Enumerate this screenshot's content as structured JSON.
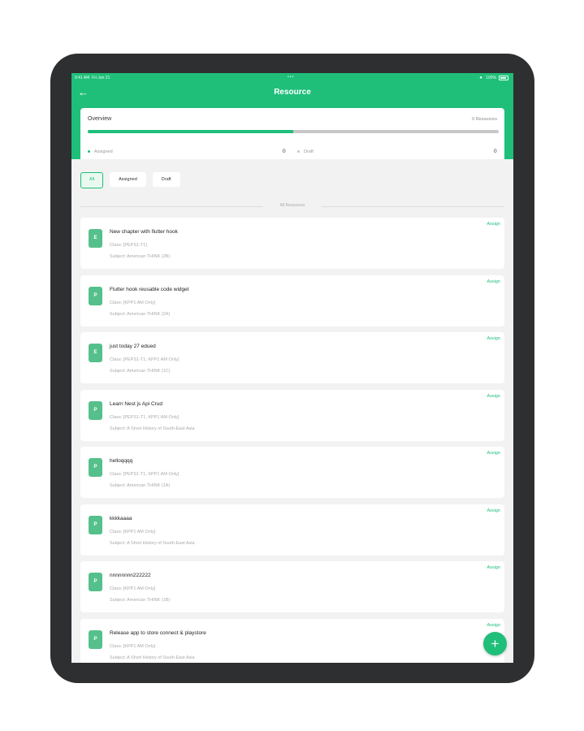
{
  "status_bar": {
    "time": "9:41 AM",
    "date": "Fri Jun 21",
    "dots": "•••",
    "battery": "100%"
  },
  "app_bar": {
    "title": "Resource",
    "back_icon": "arrow-left-icon"
  },
  "overview": {
    "title": "Overview",
    "count_label": "0 Resources",
    "progress_assigned_fraction": 0.5,
    "assigned_label": "Assigned",
    "assigned_value": "0",
    "draft_label": "Draft",
    "draft_value": "0",
    "assigned_color": "#1fbf7a",
    "draft_color": "#c8c8c8"
  },
  "filters": [
    "All",
    "Assigned",
    "Draft"
  ],
  "section_label": "All Resources",
  "resources": [
    {
      "badge": "E",
      "title": "New chapter with flutter hook",
      "class": "Class: [PEPS1-T1]",
      "subject": "Subject: American THINK (2B)",
      "action": "Assign"
    },
    {
      "badge": "P",
      "title": "Flutter hook reusable code widget",
      "class": "Class: [KPP1 AM Only]",
      "subject": "Subject: American THINK (2A)",
      "action": "Assign"
    },
    {
      "badge": "E",
      "title": "just today 27 edued",
      "class": "Class: [PEPS1-T1, KPP1 AM Only]",
      "subject": "Subject: American THINK (1C)",
      "action": "Assign"
    },
    {
      "badge": "P",
      "title": "Learn Nest js Api Crud",
      "class": "Class: [PEPS1-T1, KPP1 AM Only]",
      "subject": "Subject: A Short History of South-East Asia",
      "action": "Assign"
    },
    {
      "badge": "P",
      "title": "helloqqqq",
      "class": "Class: [PEPS1-T1, KPP1 AM Only]",
      "subject": "Subject: American THINK (1A)",
      "action": "Assign"
    },
    {
      "badge": "P",
      "title": "kkkkaaaa",
      "class": "Class: [KPP1 AM Only]",
      "subject": "Subject: A Short History of South-East Asia",
      "action": "Assign"
    },
    {
      "badge": "P",
      "title": "nnnnnnnn222222",
      "class": "Class: [KPP1 AM Only]",
      "subject": "Subject: American THINK (1B)",
      "action": "Assign"
    },
    {
      "badge": "P",
      "title": "Release app to store connect & playstore",
      "class": "Class: [KPP1 AM Only]",
      "subject": "Subject: A Short History of South-East Asia",
      "action": "Assign"
    }
  ],
  "fab": {
    "label": "+",
    "icon": "plus-icon"
  }
}
